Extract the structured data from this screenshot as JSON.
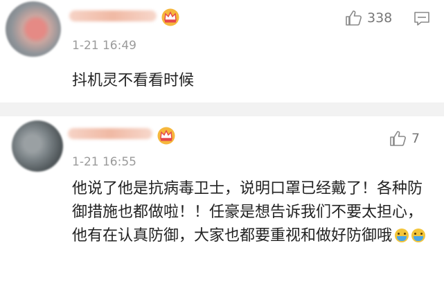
{
  "comments": [
    {
      "time": "1-21 16:49",
      "text": "抖机灵不看看时候",
      "likes": "338"
    },
    {
      "time": "1-21 16:55",
      "text": "他说了他是抗病毒卫士，说明口罩已经戴了！各种防御措施也都做啦！！任豪是想告诉我们不要太担心，他有在认真防御，大家也都要重视和做好防御哦",
      "likes": "7",
      "emojis": [
        "emoji-wearing-mask",
        "emoji-wearing-mask"
      ]
    }
  ],
  "icons": {
    "badge": "crown-icon",
    "like": "thumbs-up-icon",
    "reply": "comment-icon"
  },
  "colors": {
    "background": "#f2f2f2",
    "card": "#ffffff",
    "crown": "#e6a72a",
    "crown_red": "#e5474b"
  }
}
